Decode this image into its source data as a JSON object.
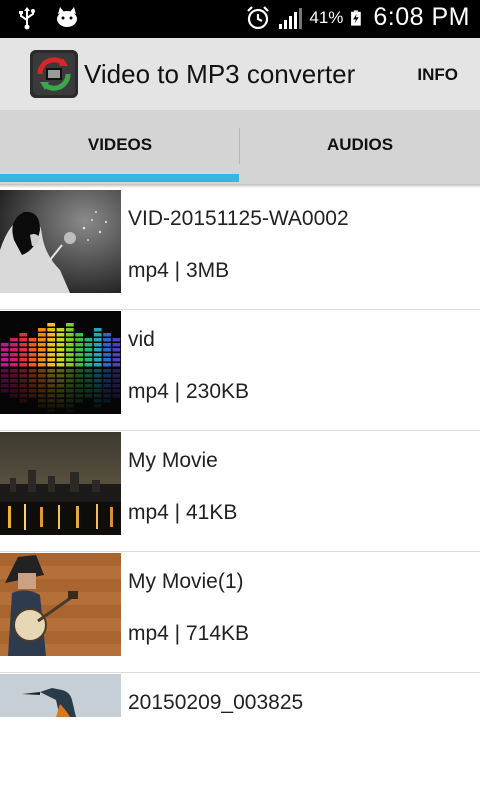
{
  "status_bar": {
    "battery_percent": "41%",
    "time": "6:08 PM",
    "icons": [
      "usb-icon",
      "cat-notification-icon",
      "alarm-icon",
      "signal-icon",
      "battery-charging-icon"
    ]
  },
  "app_bar": {
    "title": "Video to MP3 converter",
    "info_label": "INFO"
  },
  "tabs": [
    {
      "label": "VIDEOS",
      "selected": true
    },
    {
      "label": "AUDIOS",
      "selected": false
    }
  ],
  "accent_color": "#33b5e5",
  "videos": [
    {
      "title": "VID-20151125-WA0002",
      "meta": "mp4 | 3MB"
    },
    {
      "title": "vid",
      "meta": "mp4 | 230KB"
    },
    {
      "title": "My Movie",
      "meta": "mp4 | 41KB"
    },
    {
      "title": "My Movie(1)",
      "meta": "mp4 | 714KB"
    },
    {
      "title": "20150209_003825",
      "meta": ""
    }
  ]
}
